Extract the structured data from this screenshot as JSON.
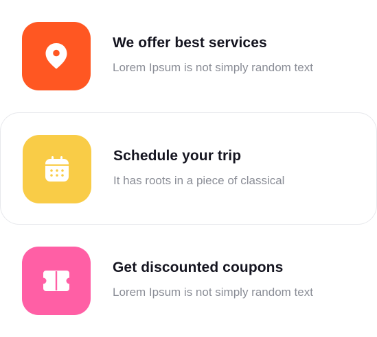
{
  "features": [
    {
      "title": "We offer best services",
      "subtitle": "Lorem Ipsum is not simply random text",
      "icon": "location-pin-icon",
      "color": "#FF5722"
    },
    {
      "title": "Schedule your trip",
      "subtitle": "It has roots in a piece of classical",
      "icon": "calendar-icon",
      "color": "#F9CC47"
    },
    {
      "title": "Get discounted coupons",
      "subtitle": "Lorem Ipsum is not simply random text",
      "icon": "ticket-icon",
      "color": "#FF5FA5"
    }
  ]
}
